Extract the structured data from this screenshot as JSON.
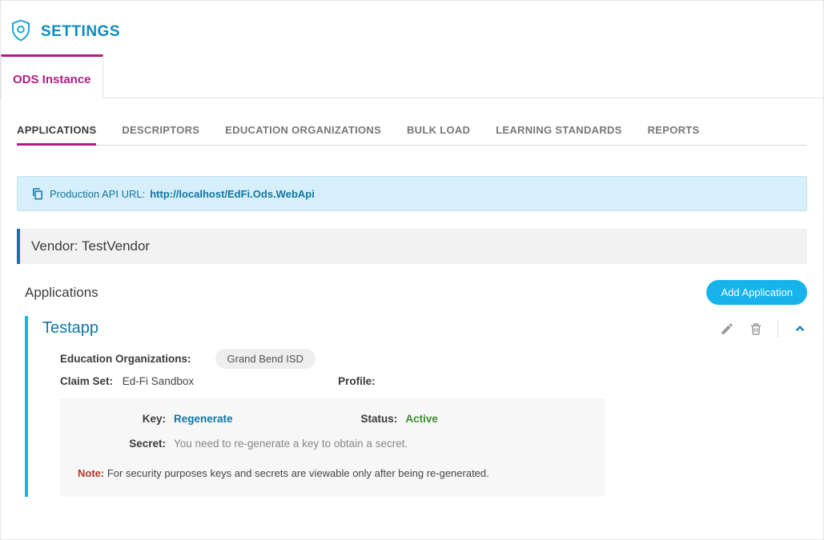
{
  "page_title": "SETTINGS",
  "main_tabs": [
    {
      "label": "ODS Instance",
      "active": true
    }
  ],
  "sub_tabs": [
    {
      "label": "APPLICATIONS",
      "active": true
    },
    {
      "label": "DESCRIPTORS",
      "active": false
    },
    {
      "label": "EDUCATION ORGANIZATIONS",
      "active": false
    },
    {
      "label": "BULK LOAD",
      "active": false
    },
    {
      "label": "LEARNING STANDARDS",
      "active": false
    },
    {
      "label": "REPORTS",
      "active": false
    }
  ],
  "banner": {
    "label": "Production API URL:",
    "url": "http://localhost/EdFi.Ods.WebApi"
  },
  "vendor": {
    "label": "Vendor:",
    "name": "TestVendor"
  },
  "applications": {
    "heading": "Applications",
    "add_button": "Add Application",
    "items": [
      {
        "name": "Testapp",
        "edorg_label": "Education Organizations:",
        "edorg": "Grand Bend ISD",
        "claimset_label": "Claim Set:",
        "claimset": "Ed-Fi Sandbox",
        "profile_label": "Profile:",
        "profile": "",
        "key_label": "Key:",
        "key_action": "Regenerate",
        "status_label": "Status:",
        "status": "Active",
        "secret_label": "Secret:",
        "secret_msg": "You need to re-generate a key to obtain a secret.",
        "note_label": "Note:",
        "note": "For security purposes keys and secrets are viewable only after being re-generated."
      }
    ]
  }
}
